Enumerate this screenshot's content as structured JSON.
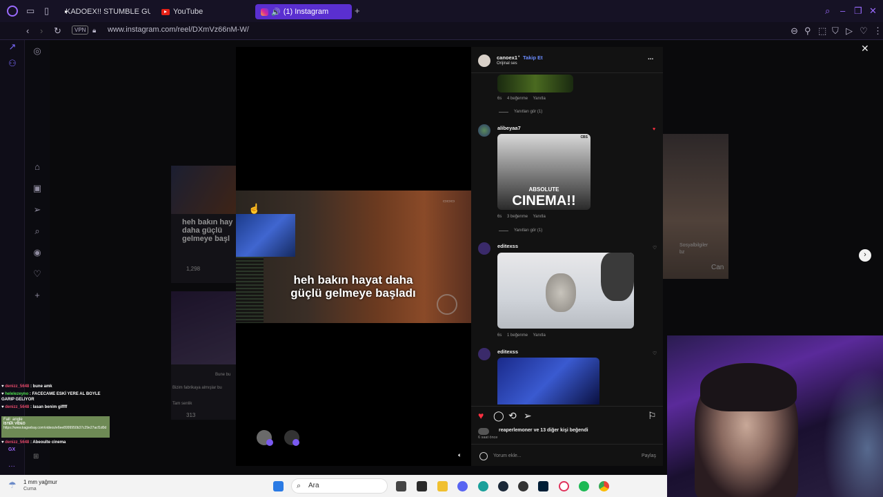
{
  "browser": {
    "tabs": [
      {
        "label": "KADOEX!! STUMBLE GUYS"
      },
      {
        "label": "YouTube"
      },
      {
        "label": "(1) Instagram"
      }
    ],
    "vpn_label": "VPN",
    "url": "www.instagram.com/reel/DXmVz66nM-W/"
  },
  "background_posts": {
    "left_caption": "heh bakın hay daha güçlü gelmeye başl",
    "left_views": "1,298",
    "left2_text1": "Bune bu",
    "left2_text2": "Bizim fabrikaya almışlar bu",
    "left2_text3": "Tam senlik",
    "left2_views": "313",
    "right_text1": "Sosyalbilgiler",
    "right_text2": "bz",
    "right_text3": "Can"
  },
  "reel": {
    "caption": "heh bakın hayat daha güçlü gelmeye başladı"
  },
  "panel": {
    "author": "canoex1",
    "separator": "•",
    "follow_label": "Takip Et",
    "audio": "Orijinal ses",
    "more_label": "...",
    "comments": [
      {
        "meta_time": "6s",
        "meta_likes": "4 beğenme",
        "meta_reply": "Yanıtla",
        "replies": "Yanıtları gör (1)"
      },
      {
        "user": "alibeyaa7",
        "gif_text_top": "ABSOLUTE",
        "gif_text_main": "CINEMA",
        "gif_badge": "CBS",
        "meta_time": "6s",
        "meta_likes": "3 beğenme",
        "meta_reply": "Yanıtla",
        "replies": "Yanıtları gör (1)"
      },
      {
        "user": "editexss",
        "meta_time": "6s",
        "meta_likes": "1 beğenme",
        "meta_reply": "Yanıtla"
      },
      {
        "user": "editexss"
      }
    ],
    "liked_by": "reaperlemoner ve 13 diğer kişi beğendi",
    "posted_ago": "6 saat önce",
    "comment_placeholder": "Yorum ekle...",
    "share_label": "Paylaş"
  },
  "chat": [
    {
      "user": "denizz_5648",
      "msg": ": bune amk"
    },
    {
      "user": "helelezeyno",
      "msg": ": FACECAME ESKİ YERE AL BOYLE GARIP GELIYOR",
      "green": true
    },
    {
      "user": "denizz_5648",
      "msg": ": lasan benim giffff"
    },
    {
      "user": "denizz_5648",
      "msg": ": Abeoulte cinema"
    }
  ],
  "fall_card": {
    "name": "Fall_angle",
    "label": "İSTEK VİDEO",
    "link": "https://www.kagsebay.com/videos/e6ee8999950b37c29e27acf1d0d"
  },
  "gx_label": "GX",
  "weather": {
    "temp": "1 mm yağmur",
    "day": "Cuma"
  },
  "taskbar": {
    "search": "Ara"
  },
  "colors": {
    "accent": "#5a2fd0",
    "follow": "#6b8cff",
    "like": "#ff3040"
  }
}
